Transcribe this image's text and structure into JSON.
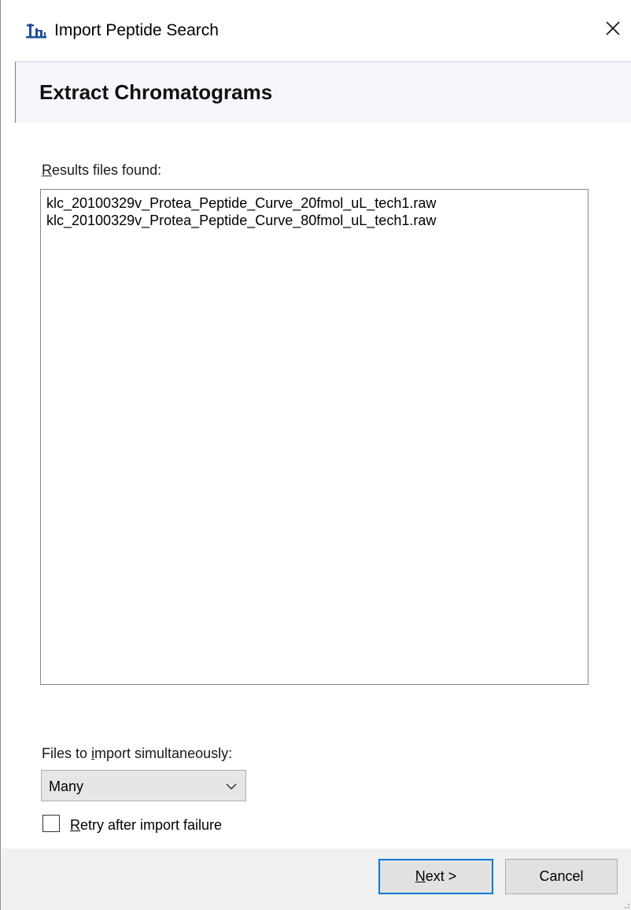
{
  "window": {
    "title": "Import Peptide Search",
    "icon": "skyline-app-icon",
    "close_icon": "close-icon"
  },
  "header": {
    "title": "Extract Chromatograms"
  },
  "results": {
    "label_prefix": "R",
    "label_rest": "esults files found:",
    "files": [
      "klc_20100329v_Protea_Peptide_Curve_20fmol_uL_tech1.raw",
      "klc_20100329v_Protea_Peptide_Curve_80fmol_uL_tech1.raw"
    ]
  },
  "simultaneous": {
    "label_before": "Files to ",
    "label_underlined": "i",
    "label_after": "mport simultaneously:",
    "selected": "Many"
  },
  "retry": {
    "label_underlined": "R",
    "label_rest": "etry after import failure",
    "checked": false
  },
  "footer": {
    "next_underlined": "N",
    "next_rest": "ext >",
    "cancel_label": "Cancel"
  },
  "colors": {
    "header_bg": "#f5f7fc",
    "footer_bg": "#f0f0f0",
    "default_button_border": "#0078d7",
    "app_icon": "#1f4e9c"
  }
}
